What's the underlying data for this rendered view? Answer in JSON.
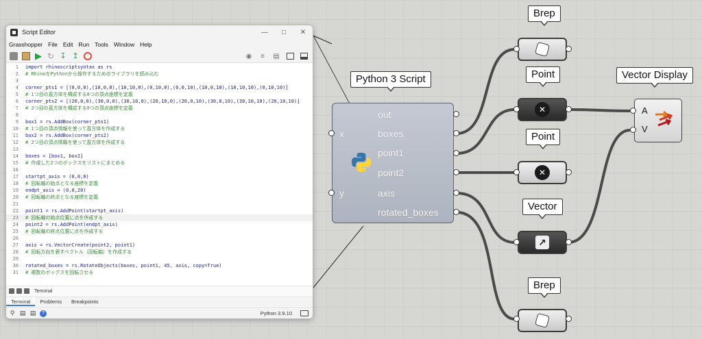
{
  "editor": {
    "title": "Script Editor",
    "menu": [
      "Grasshopper",
      "File",
      "Edit",
      "Run",
      "Tools",
      "Window",
      "Help"
    ],
    "code_lines": [
      {
        "n": "1",
        "text": "import rhinoscriptsyntax as rs",
        "comment": false
      },
      {
        "n": "2",
        "text": "# RhinoをPythonから操作するためのライブラリを読み込む",
        "comment": true
      },
      {
        "n": "3",
        "text": "",
        "comment": false
      },
      {
        "n": "4",
        "text": "corner_pts1 = [(0,0,0),(10,0,0),(10,10,0),(0,10,0),(0,0,10),(10,0,10),(10,10,10),(0,10,10)]",
        "comment": false
      },
      {
        "n": "5",
        "text": "# 1つ目の直方体を構成する8つの頂点座標を定義",
        "comment": true
      },
      {
        "n": "6",
        "text": "corner_pts2 = [(20,0,0),(30,0,0),(30,10,0),(20,10,0),(20,0,10),(30,0,10),(30,10,10),(20,10,10)]",
        "comment": false
      },
      {
        "n": "7",
        "text": "# 2つ目の直方体を構成する8つの頂点座標を定義",
        "comment": true
      },
      {
        "n": "8",
        "text": "",
        "comment": false
      },
      {
        "n": "9",
        "text": "box1 = rs.AddBox(corner_pts1)",
        "comment": false
      },
      {
        "n": "10",
        "text": "# 1つ目の頂点情報を使って直方体を作成する",
        "comment": true
      },
      {
        "n": "11",
        "text": "box2 = rs.AddBox(corner_pts2)",
        "comment": false
      },
      {
        "n": "12",
        "text": "# 2つ目の頂点情報を使って直方体を作成する",
        "comment": true
      },
      {
        "n": "13",
        "text": "",
        "comment": false
      },
      {
        "n": "14",
        "text": "boxes = [box1, box2]",
        "comment": false
      },
      {
        "n": "15",
        "text": "# 作成した2つのボックスをリストにまとめる",
        "comment": true
      },
      {
        "n": "16",
        "text": "",
        "comment": false
      },
      {
        "n": "17",
        "text": "startpt_axis = (0,0,0)",
        "comment": false
      },
      {
        "n": "18",
        "text": "# 回転軸の始点となる座標を定義",
        "comment": true
      },
      {
        "n": "19",
        "text": "endpt_axis = (0,0,20)",
        "comment": false
      },
      {
        "n": "20",
        "text": "# 回転軸の終点となる座標を定義",
        "comment": true
      },
      {
        "n": "21",
        "text": "",
        "comment": false
      },
      {
        "n": "22",
        "text": "point1 = rs.AddPoint(startpt_axis)",
        "comment": false
      },
      {
        "n": "23",
        "text": "# 回転軸の始点位置に点を作成する",
        "comment": true
      },
      {
        "n": "24",
        "text": "point2 = rs.AddPoint(endpt_axis)",
        "comment": false
      },
      {
        "n": "25",
        "text": "# 回転軸の終点位置に点を作成する",
        "comment": true
      },
      {
        "n": "26",
        "text": "",
        "comment": false
      },
      {
        "n": "27",
        "text": "axis = rs.VectorCreate(point2, point1)",
        "comment": false
      },
      {
        "n": "28",
        "text": "# 回転方向を表すベクトル（回転軸）を作成する",
        "comment": true
      },
      {
        "n": "29",
        "text": "",
        "comment": false
      },
      {
        "n": "30",
        "text": "rotated_boxes = rs.RotateObjects(boxes, point1, 45, axis, copy=True)",
        "comment": false
      },
      {
        "n": "31",
        "text": "# 複数のボックスを回転させる",
        "comment": true
      }
    ],
    "active_line": "23",
    "terminal_label": "Terminal",
    "tabs": [
      "Terminal",
      "Problems",
      "Breakpoints"
    ],
    "status_version": "Python 3.9.10"
  },
  "components": {
    "python_title": "Python 3 Script",
    "python_inputs": [
      "x",
      "y"
    ],
    "python_outputs": [
      "out",
      "boxes",
      "point1",
      "point2",
      "axis",
      "rotated_boxes"
    ],
    "brep_top_label": "Brep",
    "point_top_label": "Point",
    "point_mid_label": "Point",
    "vector_label": "Vector",
    "brep_bottom_label": "Brep",
    "vector_display_label": "Vector Display",
    "vector_display_inputs": [
      "A",
      "V"
    ]
  },
  "colors": {
    "canvas": "#d6d6d2",
    "wire": "#4a4a4a",
    "code_text": "#1a237e",
    "comment": "#3a8a3a"
  }
}
